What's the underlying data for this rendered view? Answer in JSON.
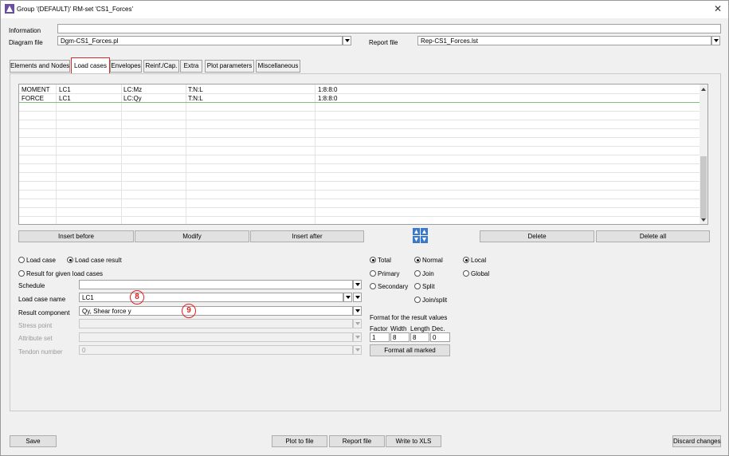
{
  "window": {
    "title": "Group '(DEFAULT)'  RM-set 'CS1_Forces'"
  },
  "header": {
    "information_label": "Information",
    "information_value": "",
    "diagram_label": "Diagram file",
    "diagram_value": "Dgm-CS1_Forces.pl",
    "report_label": "Report file",
    "report_value": "Rep-CS1_Forces.lst"
  },
  "tabs": [
    {
      "label": "Elements and Nodes"
    },
    {
      "label": "Load cases",
      "active": true
    },
    {
      "label": "Envelopes"
    },
    {
      "label": "Reinf./Cap."
    },
    {
      "label": "Extra"
    },
    {
      "label": "Plot parameters"
    },
    {
      "label": "Miscellaneous"
    }
  ],
  "grid": {
    "rows": [
      {
        "c1": "MOMENT",
        "c2": "LC1",
        "c3": "LC:Mz",
        "c4": "T:N:L",
        "c5": "1:8:8:0"
      },
      {
        "c1": "FORCE",
        "c2": "LC1",
        "c3": "LC:Qy",
        "c4": "T:N:L",
        "c5": "1:8:8:0"
      }
    ]
  },
  "grid_buttons": {
    "insert_before": "Insert before",
    "modify": "Modify",
    "insert_after": "Insert after",
    "delete": "Delete",
    "delete_all": "Delete all"
  },
  "options": {
    "load_case": "Load case",
    "load_case_result": "Load case result",
    "result_for_given": "Result for given load cases",
    "total": "Total",
    "primary": "Primary",
    "secondary": "Secondary",
    "normal": "Normal",
    "join": "Join",
    "split": "Split",
    "join_split": "Join/split",
    "local": "Local",
    "global": "Global"
  },
  "form": {
    "schedule_label": "Schedule",
    "schedule_value": "",
    "load_case_name_label": "Load case name",
    "load_case_name_value": "LC1",
    "result_component_label": "Result component",
    "result_component_value": "Qy, Shear force y",
    "stress_point_label": "Stress point",
    "stress_point_value": "",
    "attribute_set_label": "Attribute set",
    "attribute_set_value": "",
    "tendon_number_label": "Tendon number",
    "tendon_number_value": "0"
  },
  "format": {
    "title": "Format for the result values",
    "factor_label": "Factor",
    "width_label": "Width",
    "length_label": "Length",
    "dec_label": "Dec.",
    "factor_value": "1",
    "width_value": "8",
    "length_value": "8",
    "dec_value": "0",
    "format_all_button": "Format all marked"
  },
  "annotations": {
    "badge_8": "8",
    "badge_9": "9",
    "color": "#e02020"
  },
  "footer": {
    "save": "Save",
    "plot_to_file": "Plot to file",
    "report_file": "Report file",
    "write_to_xls": "Write to XLS",
    "discard_changes": "Discard changes"
  }
}
